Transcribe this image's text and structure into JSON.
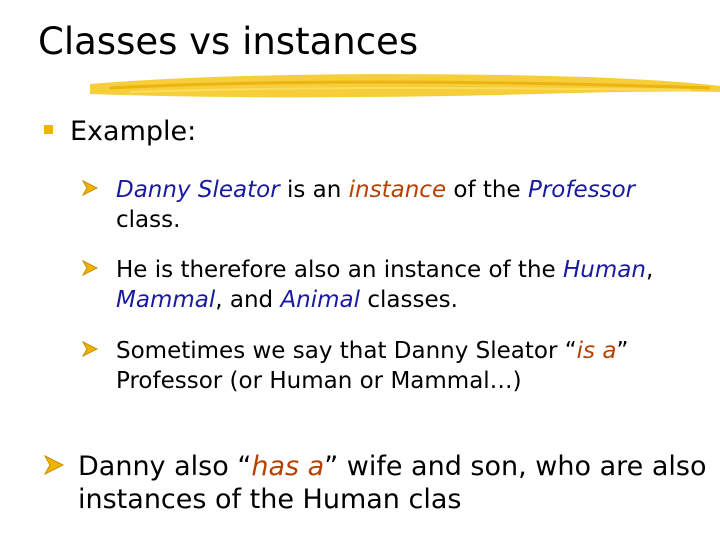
{
  "slide": {
    "title": "Classes vs instances",
    "heading": "Example:",
    "items": [
      {
        "p1": "Danny Sleator",
        "p2": " is an ",
        "p3": "instance",
        "p4": " of the ",
        "p5": "Professor",
        "p6": " class."
      },
      {
        "p1": "He is therefore also an instance of the ",
        "p2": "Human",
        "p3": ", ",
        "p4": "Mammal",
        "p5": ", and ",
        "p6": "Animal",
        "p7": " classes."
      },
      {
        "p1": "Sometimes we say that Danny Sleator “",
        "p2": "is a",
        "p3": "” Professor (or Human or Mammal…)"
      }
    ],
    "bottom": {
      "p1": "Danny also “",
      "p2": "has a",
      "p3": "” wife and son, who are also instances of the Human clas"
    }
  },
  "colors": {
    "accent_yellow": "#f0b400",
    "emphasis_blue": "#1a1aa0",
    "emphasis_red": "#b84000"
  },
  "icons": {
    "level1_bullet": "square-bullet-icon",
    "level2_bullet": "arrow-bullet-icon"
  }
}
